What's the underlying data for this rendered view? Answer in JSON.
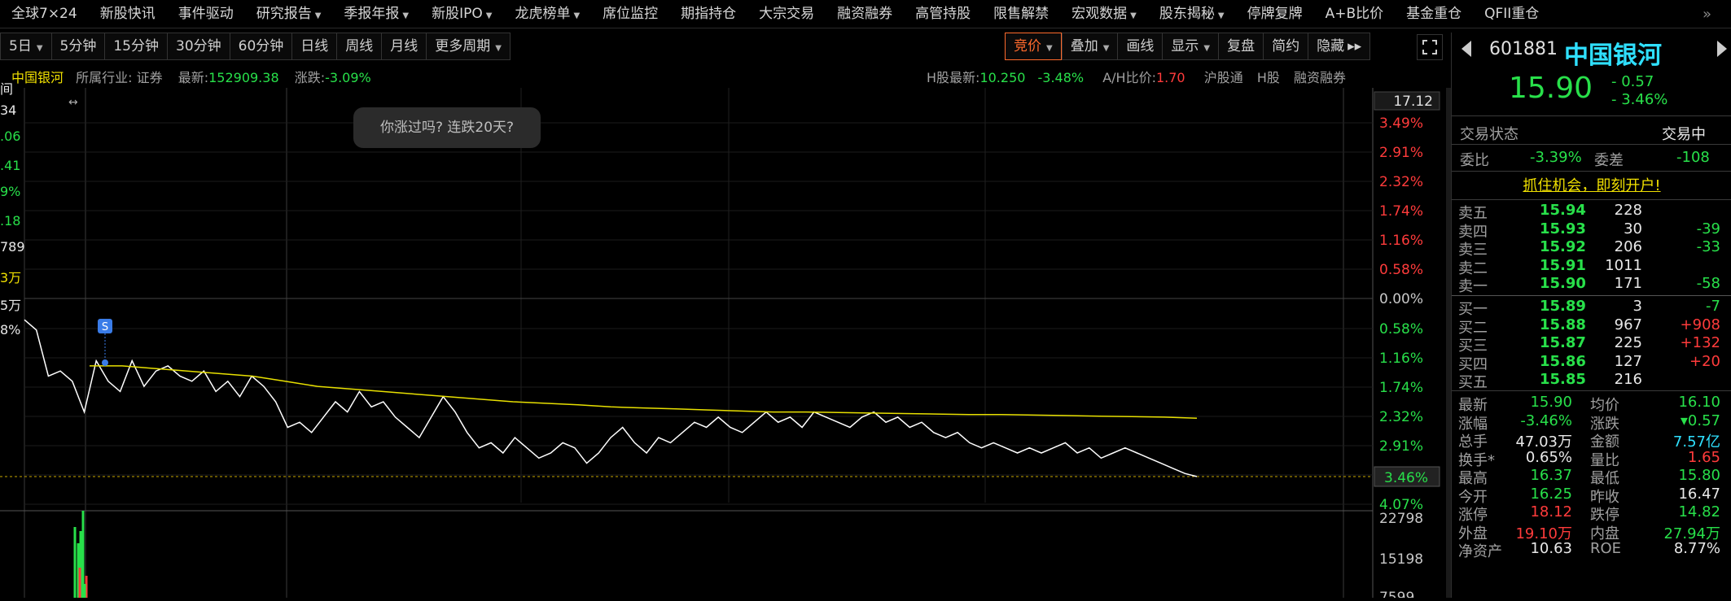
{
  "nav": [
    {
      "label": "全球7×24",
      "caret": false
    },
    {
      "label": "新股快讯",
      "caret": false
    },
    {
      "label": "事件驱动",
      "caret": false
    },
    {
      "label": "研究报告",
      "caret": true
    },
    {
      "label": "季报年报",
      "caret": true
    },
    {
      "label": "新股IPO",
      "caret": true
    },
    {
      "label": "龙虎榜单",
      "caret": true
    },
    {
      "label": "席位监控",
      "caret": false
    },
    {
      "label": "期指持仓",
      "caret": false
    },
    {
      "label": "大宗交易",
      "caret": false
    },
    {
      "label": "融资融券",
      "caret": false
    },
    {
      "label": "高管持股",
      "caret": false
    },
    {
      "label": "限售解禁",
      "caret": false
    },
    {
      "label": "宏观数据",
      "caret": true
    },
    {
      "label": "股东揭秘",
      "caret": true
    },
    {
      "label": "停牌复牌",
      "caret": false
    },
    {
      "label": "A+B比价",
      "caret": false
    },
    {
      "label": "基金重仓",
      "caret": false
    },
    {
      "label": "QFII重仓",
      "caret": false
    }
  ],
  "nav_more": "»",
  "period_buttons": [
    {
      "label": "5日",
      "caret": true
    },
    {
      "label": "5分钟",
      "caret": false
    },
    {
      "label": "15分钟",
      "caret": false
    },
    {
      "label": "30分钟",
      "caret": false
    },
    {
      "label": "60分钟",
      "caret": false
    },
    {
      "label": "日线",
      "caret": false
    },
    {
      "label": "周线",
      "caret": false
    },
    {
      "label": "月线",
      "caret": false
    },
    {
      "label": "更多周期",
      "caret": true
    }
  ],
  "tool_buttons": [
    {
      "label": "竞价",
      "caret": true,
      "active": true
    },
    {
      "label": "叠加",
      "caret": true,
      "active": false
    },
    {
      "label": "画线",
      "caret": false,
      "active": false
    },
    {
      "label": "显示",
      "caret": true,
      "active": false
    },
    {
      "label": "复盘",
      "caret": false,
      "active": false
    },
    {
      "label": "简约",
      "caret": false,
      "active": false
    },
    {
      "label": "隐藏",
      "caret": false,
      "active": false,
      "suffix": "▸▸"
    }
  ],
  "info_left": {
    "name": "中国银河",
    "industry": "所属行业: 证券",
    "latest_label": "最新:",
    "latest_value": "152909.38",
    "change_label": "涨跌:",
    "change_value": "-3.09%"
  },
  "info_right": {
    "h_latest_label": "H股最新:",
    "h_latest_value": "10.250",
    "h_change": "-3.48%",
    "ah_label": "A/H比价:",
    "ah_value": "1.70",
    "links": [
      "沪股通",
      "H股",
      "融资融券"
    ]
  },
  "tooltip": "你涨过吗? 连跌20天?",
  "left_edge": [
    "间",
    "34",
    ".06",
    ".41",
    "9%",
    ".18",
    "789",
    "3万",
    "5万",
    "8%"
  ],
  "chart_data": {
    "type": "line",
    "ylabels_right": [
      "4.07%",
      "3.49%",
      "2.91%",
      "2.32%",
      "1.74%",
      "1.16%",
      "0.58%",
      "0.00%",
      "0.58%",
      "1.16%",
      "1.74%",
      "2.32%",
      "2.91%",
      "3.46%",
      "4.07%"
    ],
    "top_value": "17.12",
    "current_pct": "3.46%",
    "volume_labels": [
      "22798",
      "15198",
      "7599"
    ],
    "marker_label": "S",
    "series": [
      {
        "color": "#ffffff",
        "values": [
          -0.4,
          -0.6,
          -1.5,
          -1.4,
          -1.6,
          -2.2,
          -1.2,
          -1.6,
          -1.8,
          -1.2,
          -1.7,
          -1.4,
          -1.3,
          -1.5,
          -1.6,
          -1.4,
          -1.8,
          -1.6,
          -1.9,
          -1.5,
          -1.7,
          -2.0,
          -2.5,
          -2.4,
          -2.6,
          -2.3,
          -2.0,
          -2.2,
          -1.8,
          -2.1,
          -2.0,
          -2.3,
          -2.5,
          -2.7,
          -2.3,
          -1.9,
          -2.2,
          -2.6,
          -2.9,
          -2.8,
          -3.0,
          -2.7,
          -2.9,
          -3.1,
          -3.0,
          -2.8,
          -2.9,
          -3.2,
          -3.0,
          -2.7,
          -2.5,
          -2.8,
          -3.0,
          -2.7,
          -2.8,
          -2.6,
          -2.4,
          -2.5,
          -2.3,
          -2.5,
          -2.6,
          -2.4,
          -2.2,
          -2.4,
          -2.3,
          -2.5,
          -2.2,
          -2.3,
          -2.4,
          -2.5,
          -2.3,
          -2.2,
          -2.4,
          -2.3,
          -2.5,
          -2.4,
          -2.6,
          -2.7,
          -2.6,
          -2.8,
          -2.9,
          -2.8,
          -2.9,
          -3.0,
          -2.9,
          -3.0,
          -2.9,
          -2.8,
          -3.0,
          -2.9,
          -3.1,
          -3.0,
          -2.9,
          -3.0,
          -3.1,
          -3.2,
          -3.3,
          -3.4,
          -3.46
        ]
      },
      {
        "color": "#e8e000",
        "values": [
          -1.3,
          -1.3,
          -1.35,
          -1.4,
          -1.45,
          -1.5,
          -1.6,
          -1.7,
          -1.75,
          -1.8,
          -1.85,
          -1.9,
          -1.95,
          -2.0,
          -2.03,
          -2.06,
          -2.1,
          -2.12,
          -2.14,
          -2.16,
          -2.18,
          -2.2,
          -2.2,
          -2.21,
          -2.22,
          -2.23,
          -2.24,
          -2.25,
          -2.25,
          -2.26,
          -2.27,
          -2.28,
          -2.29,
          -2.3,
          -2.32
        ]
      }
    ]
  },
  "right": {
    "code": "601881",
    "name": "中国银河",
    "price": "15.90",
    "chg": "- 0.57",
    "chg_pct": "- 3.46%",
    "status_label": "交易状态",
    "status_value": "交易中",
    "weibi_label": "委比",
    "weibi_value": "-3.39%",
    "weicha_label": "委差",
    "weicha_value": "-108",
    "promo": "抓住机会，即刻开户!",
    "sells": [
      {
        "label": "卖五",
        "price": "15.94",
        "vol": "228",
        "diff": ""
      },
      {
        "label": "卖四",
        "price": "15.93",
        "vol": "30",
        "diff": "-39"
      },
      {
        "label": "卖三",
        "price": "15.92",
        "vol": "206",
        "diff": "-33"
      },
      {
        "label": "卖二",
        "price": "15.91",
        "vol": "1011",
        "diff": ""
      },
      {
        "label": "卖一",
        "price": "15.90",
        "vol": "171",
        "diff": "-58"
      }
    ],
    "buys": [
      {
        "label": "买一",
        "price": "15.89",
        "vol": "3",
        "diff": "-7"
      },
      {
        "label": "买二",
        "price": "15.88",
        "vol": "967",
        "diff": "+908"
      },
      {
        "label": "买三",
        "price": "15.87",
        "vol": "225",
        "diff": "+132"
      },
      {
        "label": "买四",
        "price": "15.86",
        "vol": "127",
        "diff": "+20"
      },
      {
        "label": "买五",
        "price": "15.85",
        "vol": "216",
        "diff": ""
      }
    ],
    "stats": [
      {
        "l1": "最新",
        "v1": "15.90",
        "c1": "green",
        "l2": "均价",
        "v2": "16.10",
        "c2": "green"
      },
      {
        "l1": "涨幅",
        "v1": "-3.46%",
        "c1": "green",
        "l2": "涨跌",
        "v2": "▾0.57",
        "c2": "green"
      },
      {
        "l1": "总手",
        "v1": "47.03万",
        "c1": "white",
        "l2": "金额",
        "v2": "7.57亿",
        "c2": "cyan"
      },
      {
        "l1": "换手*",
        "v1": "0.65%",
        "c1": "white",
        "l2": "量比",
        "v2": "1.65",
        "c2": "red"
      },
      {
        "l1": "最高",
        "v1": "16.37",
        "c1": "green",
        "l2": "最低",
        "v2": "15.80",
        "c2": "green"
      },
      {
        "l1": "今开",
        "v1": "16.25",
        "c1": "green",
        "l2": "昨收",
        "v2": "16.47",
        "c2": "white"
      },
      {
        "l1": "涨停",
        "v1": "18.12",
        "c1": "red",
        "l2": "跌停",
        "v2": "14.82",
        "c2": "green"
      },
      {
        "l1": "外盘",
        "v1": "19.10万",
        "c1": "red",
        "l2": "内盘",
        "v2": "27.94万",
        "c2": "green"
      },
      {
        "l1": "净资产",
        "v1": "10.63",
        "c1": "white",
        "l2": "ROE",
        "v2": "8.77%",
        "c2": "white"
      }
    ]
  },
  "colors": {
    "up": "#ff3b3b",
    "down": "#28e04a",
    "accent": "#ff6a2c",
    "avg": "#e8e000"
  }
}
